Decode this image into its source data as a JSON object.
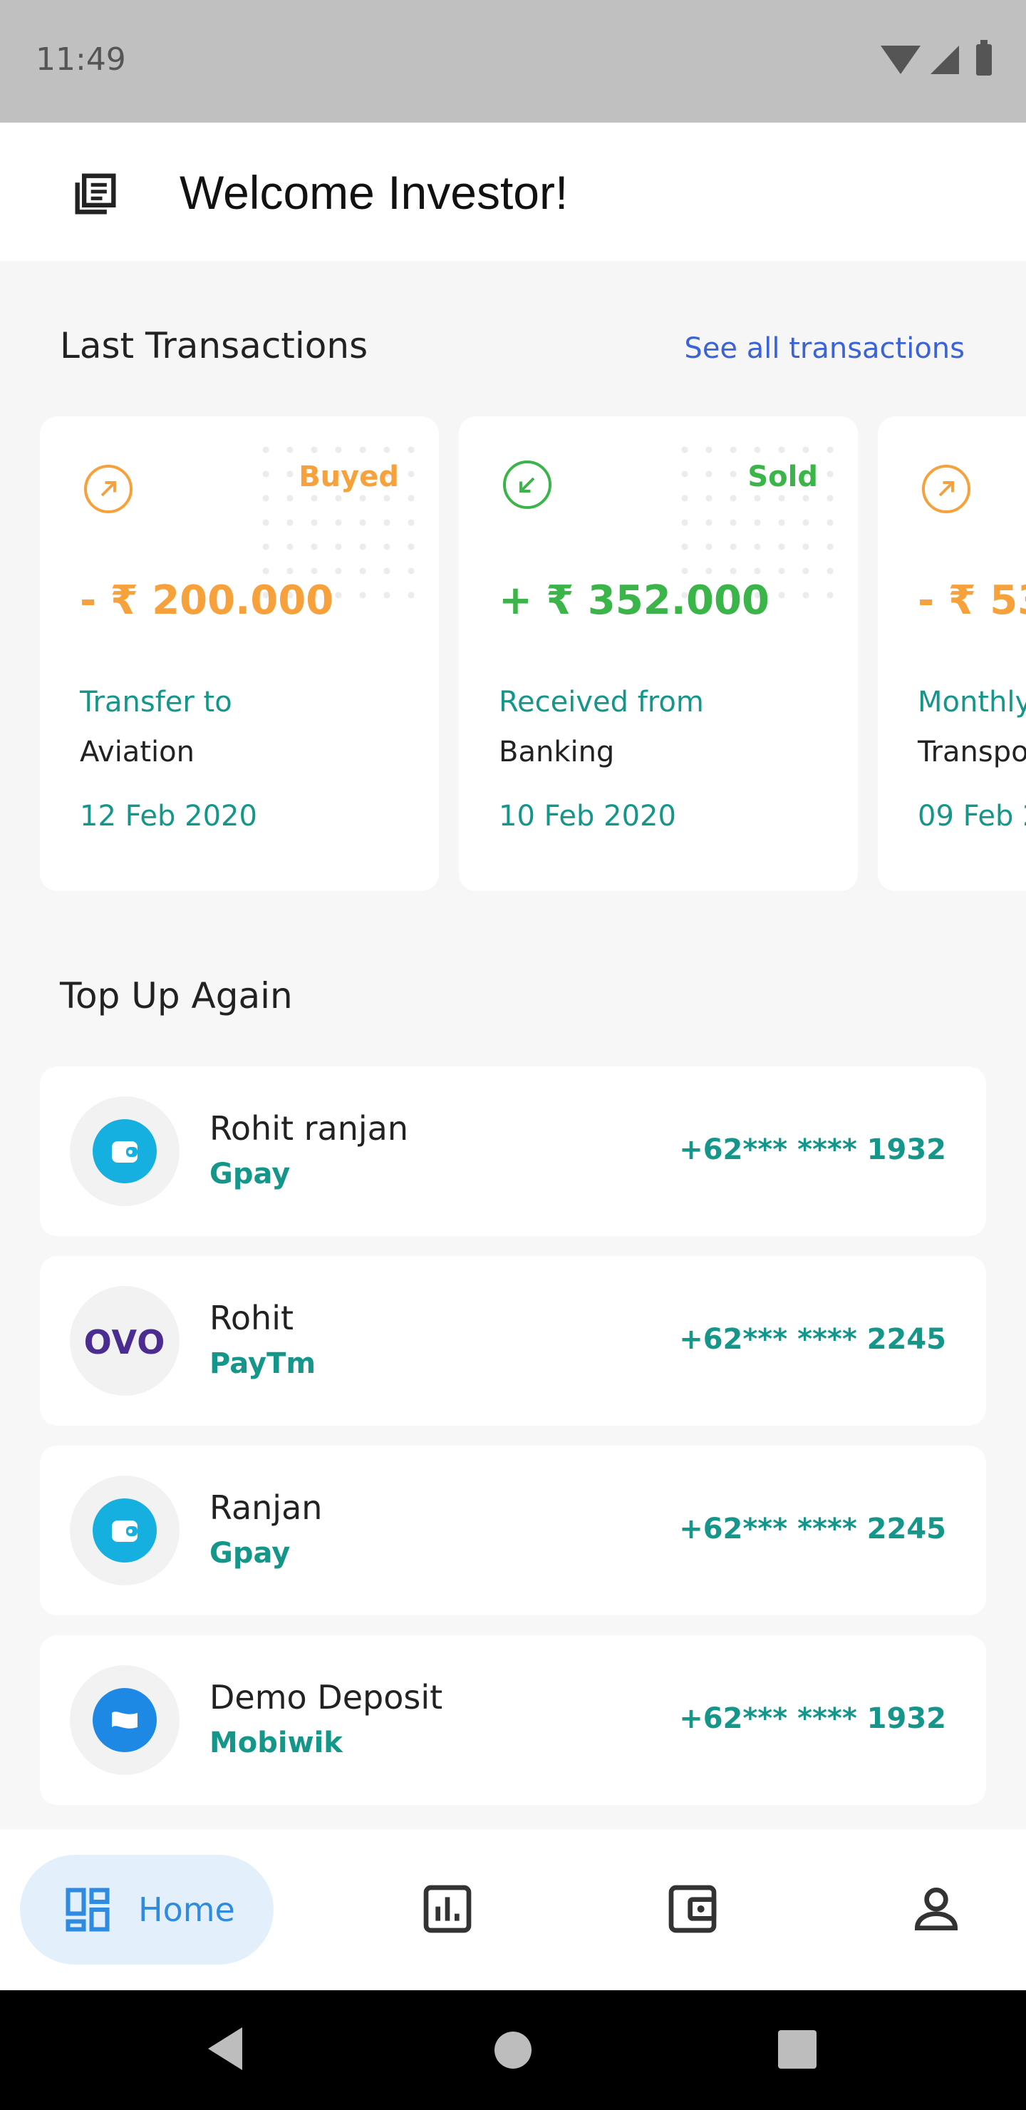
{
  "status_bar": {
    "time": "11:49"
  },
  "app_bar": {
    "title": "Welcome Investor!",
    "menu_icon": "article-icon"
  },
  "last_transactions": {
    "title": "Last Transactions",
    "see_all": "See all transactions",
    "items": [
      {
        "status": "Buyed",
        "amount": "- ₹ 200.000",
        "desc": "Transfer to",
        "target": "Aviation",
        "date": "12 Feb 2020",
        "icon": "arrow-up-right-icon",
        "color": "#f7a13c"
      },
      {
        "status": "Sold",
        "amount": "+ ₹ 352.000",
        "desc": "Received from",
        "target": "Banking",
        "date": "10 Feb 2020",
        "icon": "arrow-down-left-icon",
        "color": "#3bb44a"
      },
      {
        "status": "",
        "amount": "- ₹ 53",
        "desc": "Monthly",
        "target": "Transpo",
        "date": "09 Feb 2",
        "icon": "arrow-up-right-icon",
        "color": "#f7a13c"
      }
    ]
  },
  "top_up": {
    "title": "Top Up Again",
    "items": [
      {
        "name": "Rohit ranjan",
        "provider": "Gpay",
        "phone": "+62*** **** 1932",
        "logo": "wallet-icon",
        "logo_color": "#15b0e0"
      },
      {
        "name": "Rohit",
        "provider": "PayTm",
        "phone": "+62*** **** 2245",
        "logo": "ovo-logo",
        "logo_text": "OVO"
      },
      {
        "name": "Ranjan",
        "provider": "Gpay",
        "phone": "+62*** **** 2245",
        "logo": "wallet-icon",
        "logo_color": "#15b0e0"
      },
      {
        "name": "Demo Deposit",
        "provider": "Mobiwik",
        "phone": "+62*** **** 1932",
        "logo": "flag-icon",
        "logo_color": "#1e88e5"
      }
    ]
  },
  "bottom_nav": {
    "home_label": "Home",
    "items": [
      "home-icon",
      "bar-chart-icon",
      "wallet-icon",
      "person-icon"
    ],
    "active_color": "#2e8be0"
  }
}
